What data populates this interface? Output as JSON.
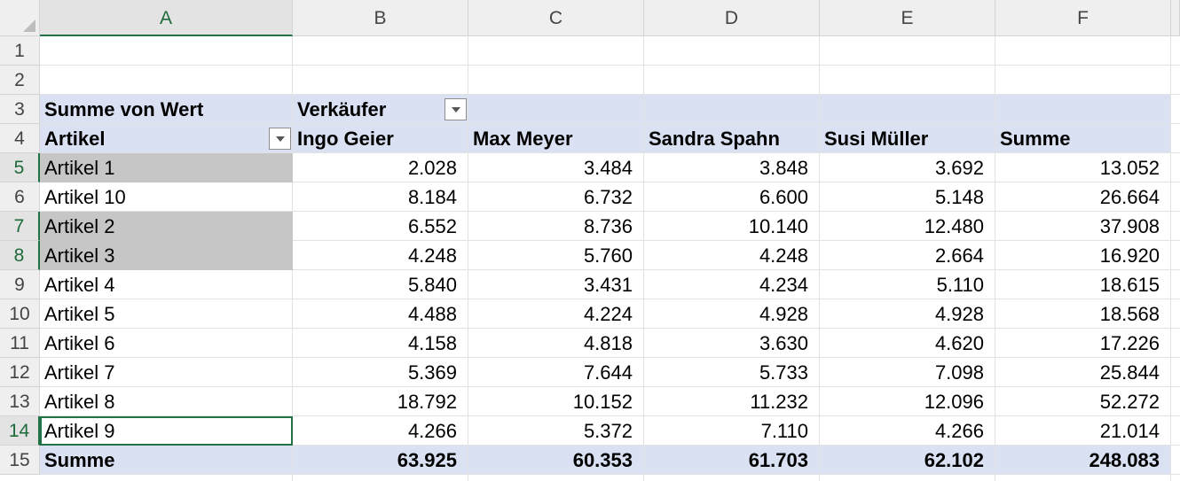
{
  "columns": [
    "A",
    "B",
    "C",
    "D",
    "E",
    "F"
  ],
  "active_column": "A",
  "rows": [
    "1",
    "2",
    "3",
    "4",
    "5",
    "6",
    "7",
    "8",
    "9",
    "10",
    "11",
    "12",
    "13",
    "14",
    "15"
  ],
  "pivot": {
    "values_label": "Summe von Wert",
    "column_field": "Verkäufer",
    "row_field": "Artikel",
    "sellers": [
      "Ingo Geier",
      "Max Meyer",
      "Sandra Spahn",
      "Susi Müller"
    ],
    "total_header": "Summe",
    "items": [
      {
        "label": "Artikel 1",
        "values": [
          "2.028",
          "3.484",
          "3.848",
          "3.692",
          "13.052"
        ],
        "selected": true
      },
      {
        "label": "Artikel 10",
        "values": [
          "8.184",
          "6.732",
          "6.600",
          "5.148",
          "26.664"
        ],
        "selected": false
      },
      {
        "label": "Artikel 2",
        "values": [
          "6.552",
          "8.736",
          "10.140",
          "12.480",
          "37.908"
        ],
        "selected": true
      },
      {
        "label": "Artikel 3",
        "values": [
          "4.248",
          "5.760",
          "4.248",
          "2.664",
          "16.920"
        ],
        "selected": true
      },
      {
        "label": "Artikel 4",
        "values": [
          "5.840",
          "3.431",
          "4.234",
          "5.110",
          "18.615"
        ],
        "selected": false
      },
      {
        "label": "Artikel 5",
        "values": [
          "4.488",
          "4.224",
          "4.928",
          "4.928",
          "18.568"
        ],
        "selected": false
      },
      {
        "label": "Artikel 6",
        "values": [
          "4.158",
          "4.818",
          "3.630",
          "4.620",
          "17.226"
        ],
        "selected": false
      },
      {
        "label": "Artikel 7",
        "values": [
          "5.369",
          "7.644",
          "5.733",
          "7.098",
          "25.844"
        ],
        "selected": false
      },
      {
        "label": "Artikel 8",
        "values": [
          "18.792",
          "10.152",
          "11.232",
          "12.096",
          "52.272"
        ],
        "selected": false
      },
      {
        "label": "Artikel 9",
        "values": [
          "4.266",
          "5.372",
          "7.110",
          "4.266",
          "21.014"
        ],
        "selected": false,
        "active": true
      }
    ],
    "grand_total": {
      "label": "Summe",
      "values": [
        "63.925",
        "60.353",
        "61.703",
        "62.102",
        "248.083"
      ]
    }
  },
  "colors": {
    "pivot_band": "#d9e1f2",
    "selection": "#c6c6c6",
    "excel_green": "#217346"
  }
}
